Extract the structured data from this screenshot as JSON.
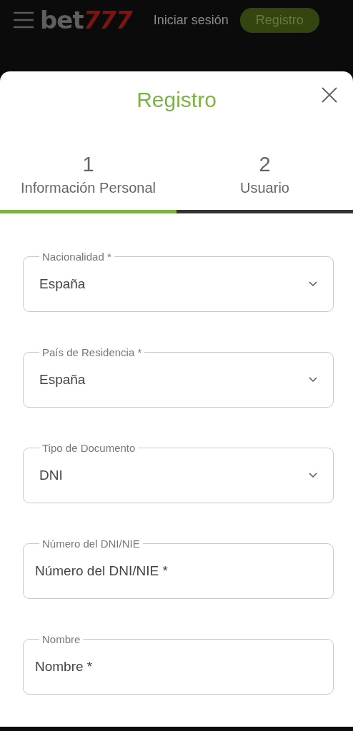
{
  "header": {
    "logo": {
      "prefix": "bet",
      "suffix": "777"
    },
    "login": "Iniciar sesión",
    "register": "Registro"
  },
  "modal": {
    "title": "Registro",
    "steps": [
      {
        "number": "1",
        "label": "Información Personal",
        "selected": true
      },
      {
        "number": "2",
        "label": "Usuario",
        "selected": false
      }
    ],
    "fields": [
      {
        "kind": "select",
        "label": "Nacionalidad *",
        "value": "España"
      },
      {
        "kind": "select",
        "label": "País de Residencia *",
        "value": "España"
      },
      {
        "kind": "select",
        "label": "Tipo de Documento",
        "value": "DNI"
      },
      {
        "kind": "text",
        "label": "Número del DNI/NIE",
        "placeholder": "Número del DNI/NIE *"
      },
      {
        "kind": "text",
        "label": "Nombre",
        "placeholder": "Nombre *"
      }
    ]
  }
}
